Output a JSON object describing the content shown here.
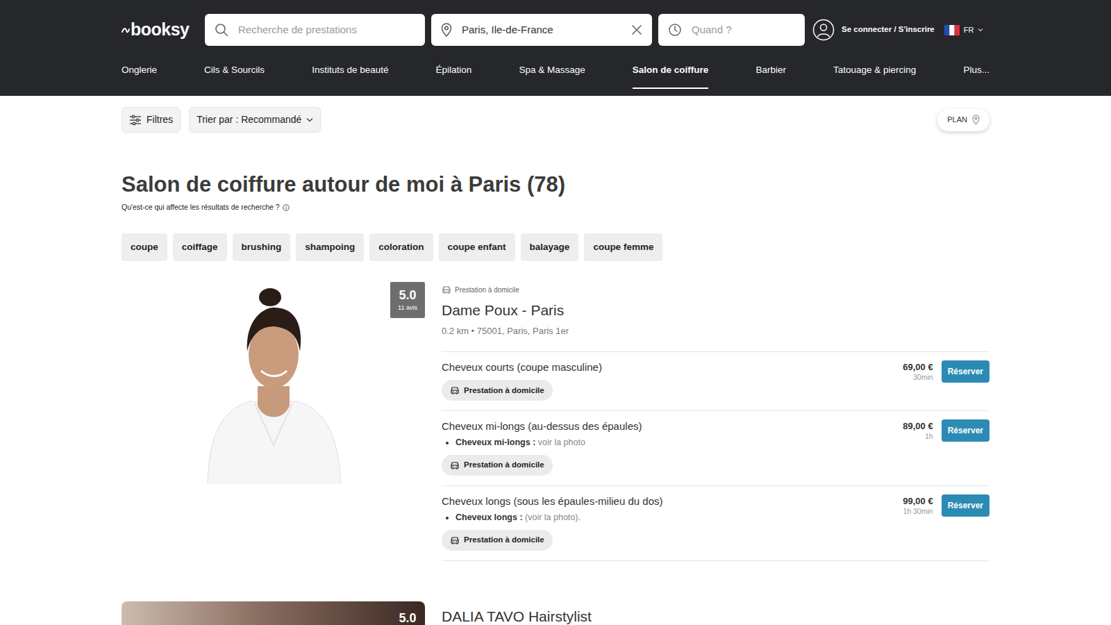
{
  "header": {
    "logo": "booksy",
    "search": {
      "placeholder": "Recherche de prestations"
    },
    "location": {
      "value": "Paris, Ile-de-France"
    },
    "when": {
      "placeholder": "Quand ?"
    },
    "login": "Se connecter / S'inscrire",
    "language": "FR"
  },
  "categories": [
    {
      "label": "Onglerie",
      "selected": false
    },
    {
      "label": "Cils & Sourcils",
      "selected": false
    },
    {
      "label": "Instituts de beauté",
      "selected": false
    },
    {
      "label": "Épilation",
      "selected": false
    },
    {
      "label": "Spa & Massage",
      "selected": false
    },
    {
      "label": "Salon de coiffure",
      "selected": true
    },
    {
      "label": "Barbier",
      "selected": false
    },
    {
      "label": "Tatouage & piercing",
      "selected": false
    },
    {
      "label": "Plus...",
      "selected": false
    }
  ],
  "toolbar": {
    "filters": "Filtres",
    "sort": "Trier par : Recommandé",
    "map": "PLAN"
  },
  "title": "Salon de coiffure autour de moi à Paris (78)",
  "subtitle": "Qu'est-ce qui affecte les résultats de recherche ?",
  "chips": [
    "coupe",
    "coiffage",
    "brushing",
    "shampoing",
    "coloration",
    "coupe enfant",
    "balayage",
    "coupe femme"
  ],
  "listings": [
    {
      "rating": "5.0",
      "reviews": "11 avis",
      "badge": "Prestation à domicile",
      "name": "Dame Poux - Paris",
      "address": "0.2 km • 75001, Paris, Paris 1er",
      "services": [
        {
          "name": "Cheveux courts (coupe masculine)",
          "tag": "Prestation à domicile",
          "price": "69,00 €",
          "duration": "30min",
          "button": "Réserver"
        },
        {
          "name": "Cheveux mi-longs (au-dessus des épaules)",
          "detail": {
            "label": "Cheveux mi-longs :",
            "value": "voir la photo"
          },
          "tag": "Prestation à domicile",
          "price": "89,00 €",
          "duration": "1h",
          "button": "Réserver"
        },
        {
          "name": "Cheveux longs (sous les épaules-milieu du dos)",
          "detail": {
            "label": "Cheveux longs :",
            "value": "(voir la photo)."
          },
          "tag": "Prestation à domicile",
          "price": "99,00 €",
          "duration": "1h 30min",
          "button": "Réserver"
        }
      ]
    },
    {
      "rating": "5.0",
      "name": "DALIA TAVO Hairstylist"
    }
  ]
}
